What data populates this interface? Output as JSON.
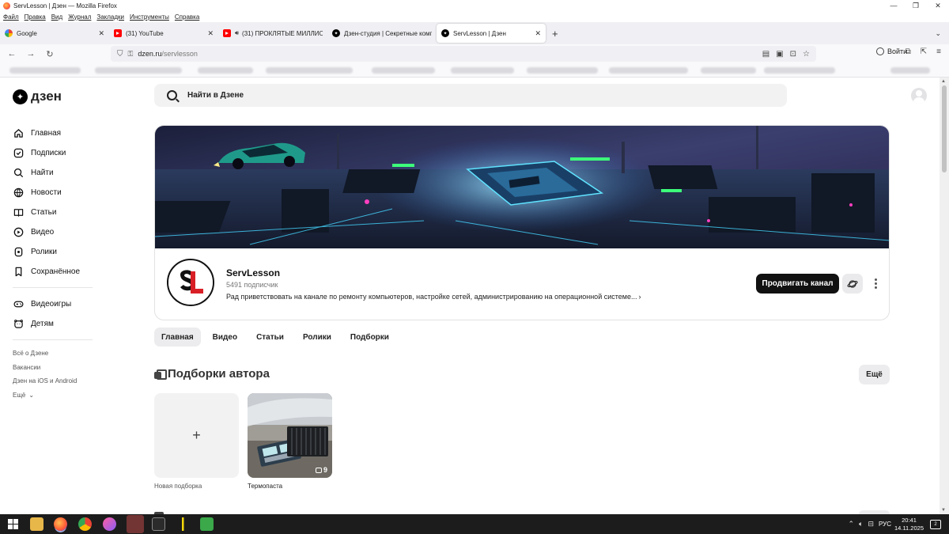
{
  "window": {
    "title": "ServLesson | Дзен — Mozilla Firefox"
  },
  "menubar": [
    "Файл",
    "Правка",
    "Вид",
    "Журнал",
    "Закладки",
    "Инструменты",
    "Справка"
  ],
  "tabs": [
    {
      "title": "Google",
      "favicon": "google-icon",
      "active": false
    },
    {
      "title": "(31) YouTube",
      "favicon": "youtube-icon",
      "active": false
    },
    {
      "title": "(31) ПРОКЛЯТЫЕ МИЛЛИО",
      "favicon": "youtube-icon",
      "active": false,
      "playing_audio": true
    },
    {
      "title": "Дзен-студия | Секретные комп",
      "favicon": "dzen-icon",
      "active": false
    },
    {
      "title": "ServLesson | Дзен",
      "favicon": "dzen-icon",
      "active": true
    }
  ],
  "urlbar": {
    "host": "dzen.ru",
    "path": "/servlesson"
  },
  "toolbar": {
    "login_label": "Войти"
  },
  "site": {
    "logo_text": "дзен",
    "search_placeholder": "Найти в Дзене"
  },
  "sidebar": {
    "items": [
      {
        "label": "Главная",
        "icon": "home-icon"
      },
      {
        "label": "Подписки",
        "icon": "subscriptions-icon"
      },
      {
        "label": "Найти",
        "icon": "search-icon"
      },
      {
        "label": "Новости",
        "icon": "news-icon"
      },
      {
        "label": "Статьи",
        "icon": "articles-icon"
      },
      {
        "label": "Видео",
        "icon": "video-icon"
      },
      {
        "label": "Ролики",
        "icon": "clips-icon"
      },
      {
        "label": "Сохранённое",
        "icon": "bookmark-icon"
      }
    ],
    "items2": [
      {
        "label": "Видеоигры",
        "icon": "gamepad-icon"
      },
      {
        "label": "Детям",
        "icon": "kids-icon"
      }
    ],
    "links": [
      "Всё о Дзене",
      "Вакансии",
      "Дзен на iOS и Android",
      "Ещё"
    ]
  },
  "channel": {
    "name": "ServLesson",
    "subscribers": "5491 подписчик",
    "description": "Рад приветствовать на канале по ремонту компьютеров, настройке сетей, администрированию на операционной системе...",
    "promote_label": "Продвигать канал"
  },
  "channel_tabs": [
    "Главная",
    "Видео",
    "Статьи",
    "Ролики",
    "Подборки"
  ],
  "collections_section": {
    "title": "Подборки автора",
    "more_label": "Ещё",
    "items": [
      {
        "caption": "Новая подборка"
      },
      {
        "caption": "Термопаста",
        "count": "9"
      }
    ]
  },
  "taskbar": {
    "language": "РУС",
    "time": "20:41",
    "date": "14.11.2025",
    "notifications": "2"
  },
  "colors": {
    "accent_dark": "#111111",
    "chip_bg": "#ececee",
    "taskbar": "#1c1c1c"
  }
}
